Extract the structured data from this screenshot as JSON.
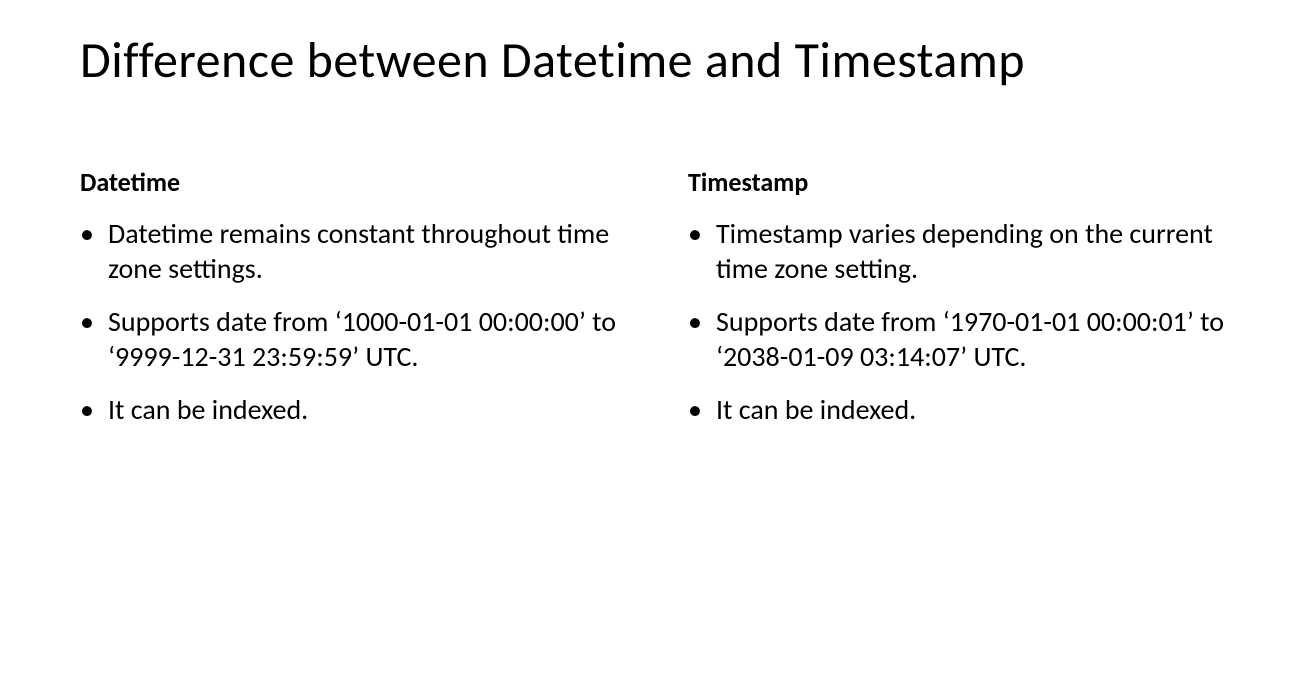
{
  "title": "Difference between Datetime and Timestamp",
  "left": {
    "heading": "Datetime",
    "bullets": [
      "Datetime remains constant throughout time zone settings.",
      "Supports date from ‘1000-01-01 00:00:00’ to ‘9999-12-31 23:59:59’ UTC.",
      "It can be indexed."
    ]
  },
  "right": {
    "heading": "Timestamp",
    "bullets": [
      "Timestamp varies depending on the current time zone setting.",
      "Supports date from ‘1970-01-01 00:00:01’ to ‘2038-01-09 03:14:07’ UTC.",
      "It can be indexed."
    ]
  }
}
